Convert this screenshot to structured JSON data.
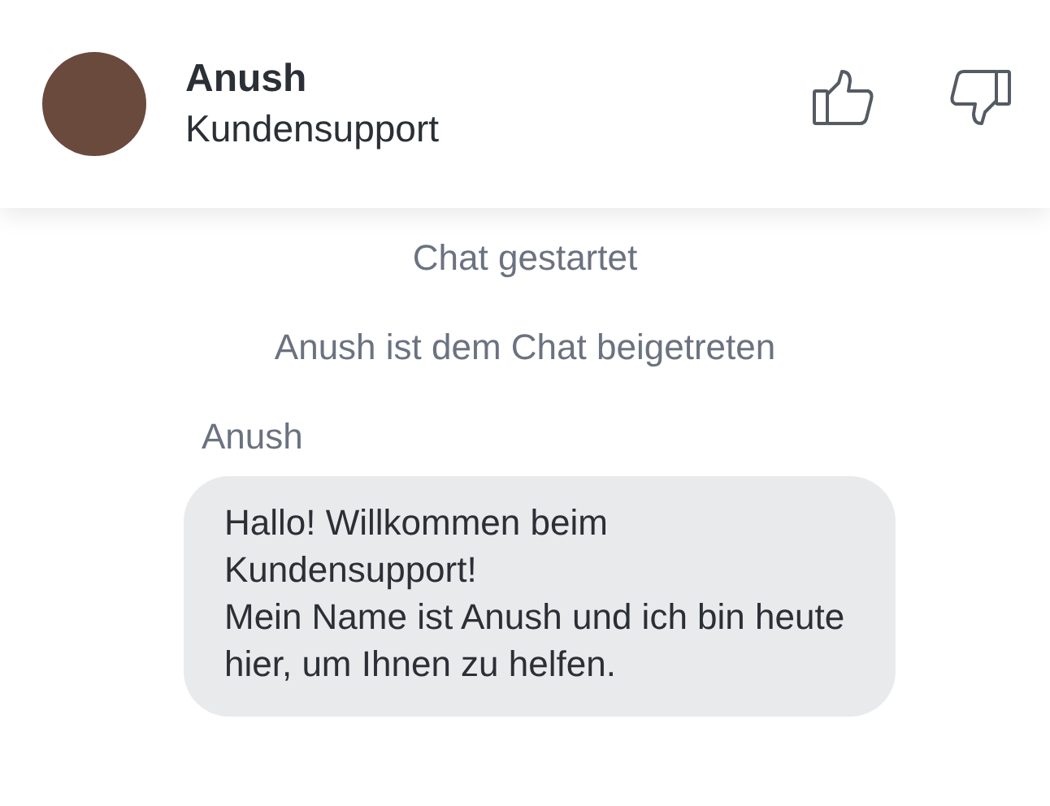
{
  "header": {
    "agent_name": "Anush",
    "agent_role": "Kundensupport"
  },
  "events": [
    "Chat gestartet",
    "Anush ist dem Chat beigetreten"
  ],
  "messages": [
    {
      "sender": "Anush",
      "paragraphs": [
        "Hallo! Willkommen beim Kundensupport!",
        "Mein Name ist Anush und ich bin heute hier, um Ihnen zu helfen."
      ]
    }
  ]
}
